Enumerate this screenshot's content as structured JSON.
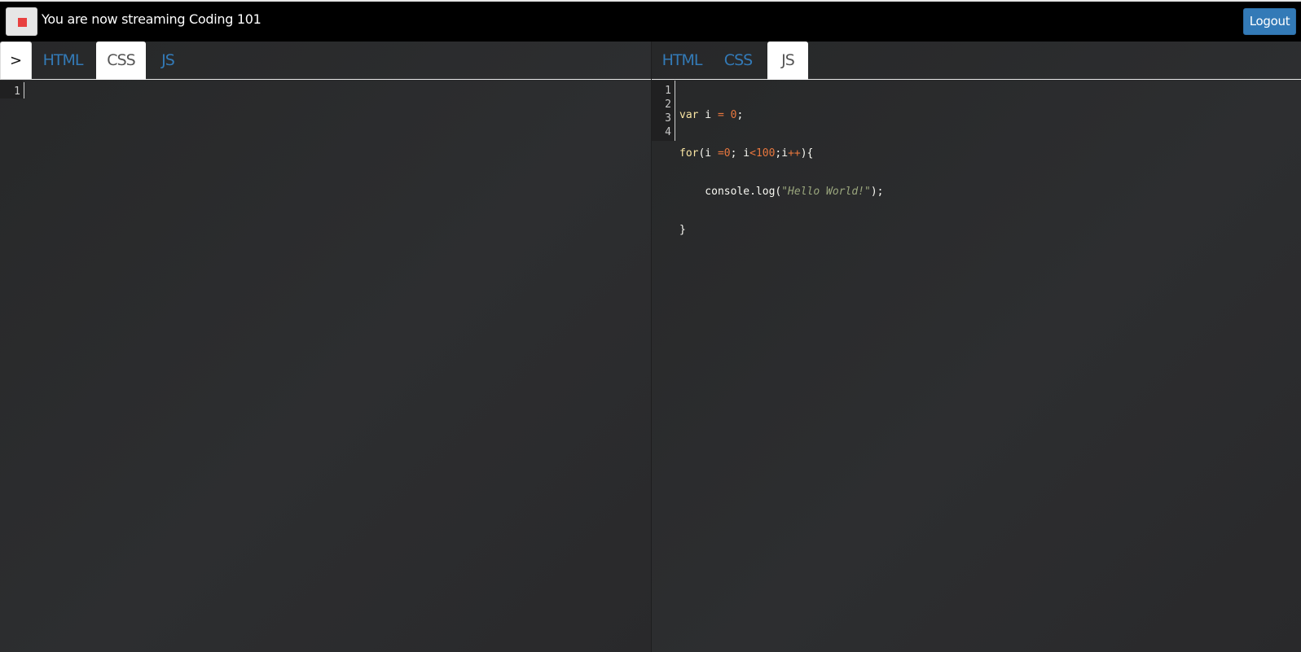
{
  "header": {
    "stream_status": "You are now streaming Coding 101",
    "logout_label": "Logout",
    "stop_color": "#e8403f"
  },
  "left_pane": {
    "toggle_icon": "chevron-right-icon",
    "toggle_glyph": ">",
    "tabs": [
      {
        "label": "HTML",
        "active": false
      },
      {
        "label": "CSS",
        "active": true
      },
      {
        "label": "JS",
        "active": false
      }
    ],
    "line_numbers": [
      "1"
    ]
  },
  "right_pane": {
    "tabs": [
      {
        "label": "HTML",
        "active": false
      },
      {
        "label": "CSS",
        "active": false
      },
      {
        "label": "JS",
        "active": true
      }
    ],
    "line_numbers": [
      "1",
      "2",
      "3",
      "4"
    ],
    "code_lines": [
      "var i = 0;",
      "for(i =0; i<100;i++){",
      "    console.log(\"Hello World!\");",
      "}"
    ]
  },
  "colors": {
    "accent": "#337ab7",
    "keyword": "#f9e5a3",
    "number": "#e8773e",
    "string": "#9aa67d"
  }
}
